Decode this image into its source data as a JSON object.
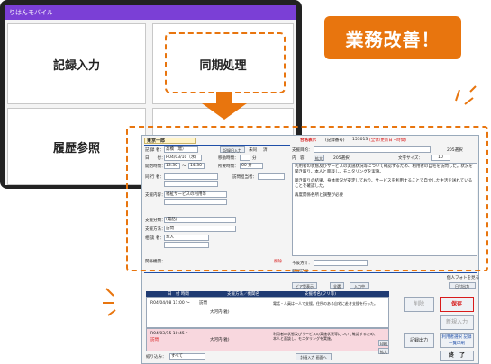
{
  "tablet": {
    "app_title": "りはんモバイル",
    "tiles": {
      "record_input": "記録入力",
      "sync": "同期処理",
      "history": "履歴参照"
    }
  },
  "banner": {
    "text": "業務改善！"
  },
  "form": {
    "patient_name": "東京一郎",
    "tabs": {
      "tab1": "合格表示",
      "tab2": "(記録番号)",
      "tab3": "153013",
      "tab4": "(全体/更新日・時間)"
    },
    "record_author": {
      "label": "記 録 者：",
      "value": "高橋（瑠）",
      "button": "記録日入力",
      "radio1": "未同",
      "radio2": "済"
    },
    "date_row": {
      "label": "日　　付：",
      "value": "R04/03/10（水)",
      "travel_label": "移動時間：",
      "travel_value": "分"
    },
    "time_row": {
      "label": "開始時間：",
      "start": "13:30",
      "sep": "～",
      "end": "14:30",
      "duration_label": "所要時間：",
      "duration_value": "60 分"
    },
    "companion": {
      "label": "同 行 者：",
      "visitor_label": "訪問担当者："
    },
    "support_content": {
      "label": "支援内容：",
      "value": "福祉サービスの利用等"
    },
    "support_type": {
      "label": "支援分類：",
      "value": "(電話)"
    },
    "support_method": {
      "label": "支援方法：",
      "value": "訪問"
    },
    "partner": {
      "label": "相 談 者：",
      "value": "本人"
    },
    "related": {
      "label": "関係機関：",
      "delete": "削除"
    },
    "text_area": {
      "purpose_label": "支援目的：",
      "content_label": "内　容：",
      "expand": "拡大",
      "selection_note": "205選択",
      "font_size_label": "文字サイズ：",
      "font_size": "10",
      "paragraph1": "利用者の状態及びサービスの実施状況等について確認するため、利用者の自宅を訪問した。状況を聞き取り、本人と面談し、モニタリングを実施。",
      "paragraph2": "聴き取りの結果、身体状況が安定しており、サービスを利用することで自立した生活を送れていることを確認した。",
      "paragraph3": "再度関係各所と調整が必要"
    },
    "next_plan": {
      "label": "今後方針："
    },
    "new_record": {
      "label": "新規記録"
    },
    "side_links": {
      "l1": "個人フォトを見る",
      "l2": "日付出力"
    },
    "toolbar": {
      "b1": "ビア型表示",
      "b2": "全選",
      "b3": "入力中"
    },
    "table": {
      "headers": [
        "日　付 時間",
        "支援方法／機関名",
        "支援者名(フリ等)"
      ],
      "rows": [
        {
          "date": "R04/04/08 11:00 ～",
          "method": "訪問",
          "person": "大河内(雅)",
          "note": "電話・人員は一人で支援。住所のある自宅に赴き支援を行った。"
        },
        {
          "date": "R04/03/15 10:45 ～",
          "method": "訪問",
          "person": "大河内(雅)",
          "note": "利用者の状態及びサービスの実施状況等について確認するため、本人と面談し、モニタリングを実施。",
          "highlight": true
        }
      ],
      "filter_label": "絞り込み：",
      "filter_value": "すべて"
    },
    "right_buttons": {
      "delete": "削除",
      "save": "保存",
      "new_input": "新規入力",
      "record_output": "記録出力",
      "user_link": "利用者選択 記録一覧印刷",
      "finish": "終　了",
      "print": "印刷",
      "enlarge": "拡大"
    },
    "bottom_btn": "計画入力 画面へ"
  }
}
